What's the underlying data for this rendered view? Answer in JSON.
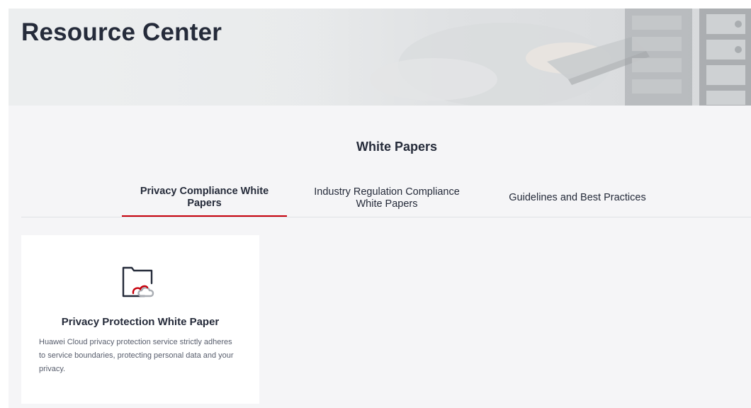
{
  "banner": {
    "title": "Resource Center"
  },
  "section": {
    "title": "White Papers"
  },
  "tabs": [
    {
      "label": "Privacy Compliance White Papers",
      "active": true
    },
    {
      "label": "Industry Regulation Compliance White Papers",
      "active": false
    },
    {
      "label": "Guidelines and Best Practices",
      "active": false
    }
  ],
  "cards": [
    {
      "icon": "folder-cloud-icon",
      "title": "Privacy Protection White Paper",
      "description": "Huawei Cloud privacy protection service strictly adheres to service boundaries, protecting personal data and your privacy."
    }
  ],
  "colors": {
    "accent": "#c7000b",
    "page_background": "#f5f5f7",
    "text_primary": "#252b3a",
    "text_secondary": "#575d6c"
  }
}
